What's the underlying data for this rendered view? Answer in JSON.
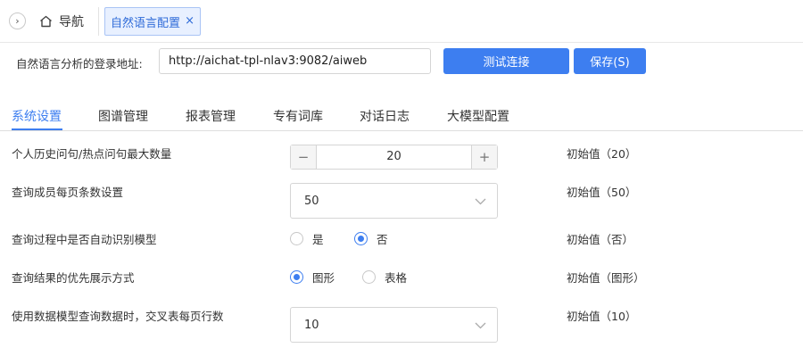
{
  "tabbar": {
    "home_label": "导航",
    "active_tab_label": "自然语言配置",
    "close_glyph": "×",
    "collapse_glyph": "›"
  },
  "login": {
    "label": "自然语言分析的登录地址:",
    "address": "http://aichat-tpl-nlav3:9082/aiweb",
    "test_button": "测试连接",
    "save_button": "保存(S)"
  },
  "section_tabs": [
    "系统设置",
    "图谱管理",
    "报表管理",
    "专有词库",
    "对话日志",
    "大模型配置"
  ],
  "active_section": "系统设置",
  "settings": [
    {
      "label": "个人历史问句/热点问句最大数量",
      "control": "stepper",
      "value": "20",
      "minus": "−",
      "plus": "+",
      "initial": "初始值（20）"
    },
    {
      "label": "查询成员每页条数设置",
      "control": "select",
      "value": "50",
      "initial": "初始值（50）"
    },
    {
      "label": "查询过程中是否自动识别模型",
      "control": "radio",
      "options": [
        "是",
        "否"
      ],
      "selected": "否",
      "initial": "初始值（否）"
    },
    {
      "label": "查询结果的优先展示方式",
      "control": "radio",
      "options": [
        "图形",
        "表格"
      ],
      "selected": "图形",
      "initial": "初始值（图形）"
    },
    {
      "label": "使用数据模型查询数据时，交叉表每页行数",
      "control": "select",
      "value": "10",
      "initial": "初始值（10）"
    }
  ],
  "colors": {
    "accent": "#3d7ef0",
    "active_tab_bg": "#e8f0ff"
  },
  "icons": {
    "collapse": "chevron-right-icon",
    "home": "home-icon",
    "close": "close-icon",
    "dropdown": "chevron-down-icon"
  }
}
